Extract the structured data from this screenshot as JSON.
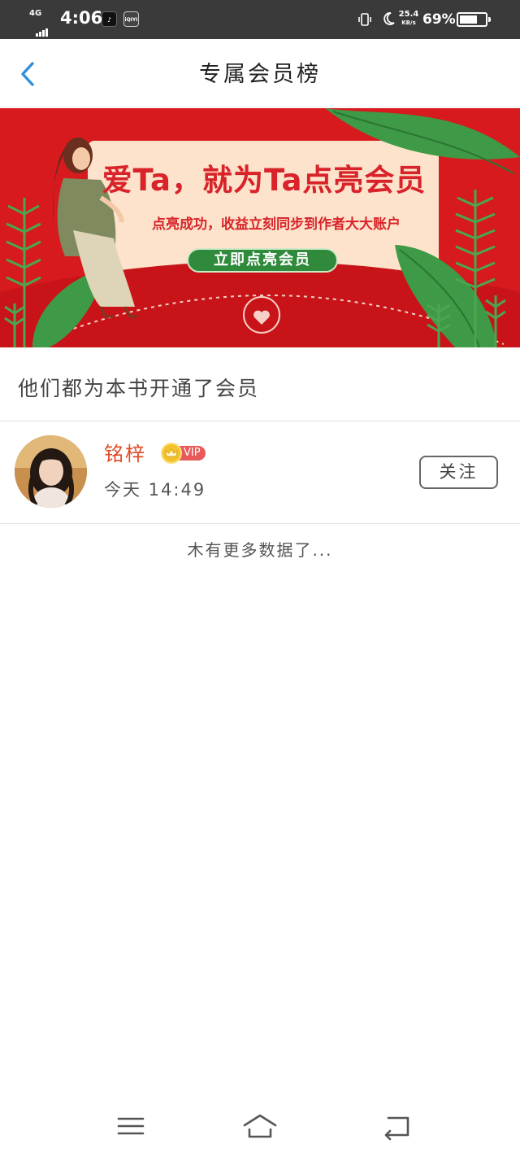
{
  "status_bar": {
    "network": "4G",
    "time": "4:06",
    "app_icons": [
      "tiktok-icon",
      "iqiyi-icon"
    ],
    "iqiyi_label": "iQIYI",
    "speed_value": "25.4",
    "speed_unit": "KB/s",
    "battery_percent": "69%",
    "battery_level": 0.69
  },
  "header": {
    "back_icon": "chevron-left-icon",
    "title": "专属会员榜"
  },
  "banner": {
    "headline": "爱Ta，就为Ta点亮会员",
    "subtitle": "点亮成功，收益立刻同步到作者大大账户",
    "cta_label": "立即点亮会员",
    "colors": {
      "background": "#d61a1e",
      "card": "#fde3cb",
      "cta": "#2f8a3c",
      "leaf": "#3e9a47"
    }
  },
  "section": {
    "heading": "他们都为本书开通了会员"
  },
  "members": [
    {
      "name": "铭梓",
      "badge": "VIP",
      "time": "今天 14:49",
      "follow_label": "关注"
    }
  ],
  "list_footer": "木有更多数据了...",
  "nav_bar": {
    "icons": [
      "menu-icon",
      "home-icon",
      "back-icon"
    ]
  },
  "colors": {
    "accent": "#2d8fde",
    "name": "#e24a24",
    "vip": "#e85a5a"
  }
}
